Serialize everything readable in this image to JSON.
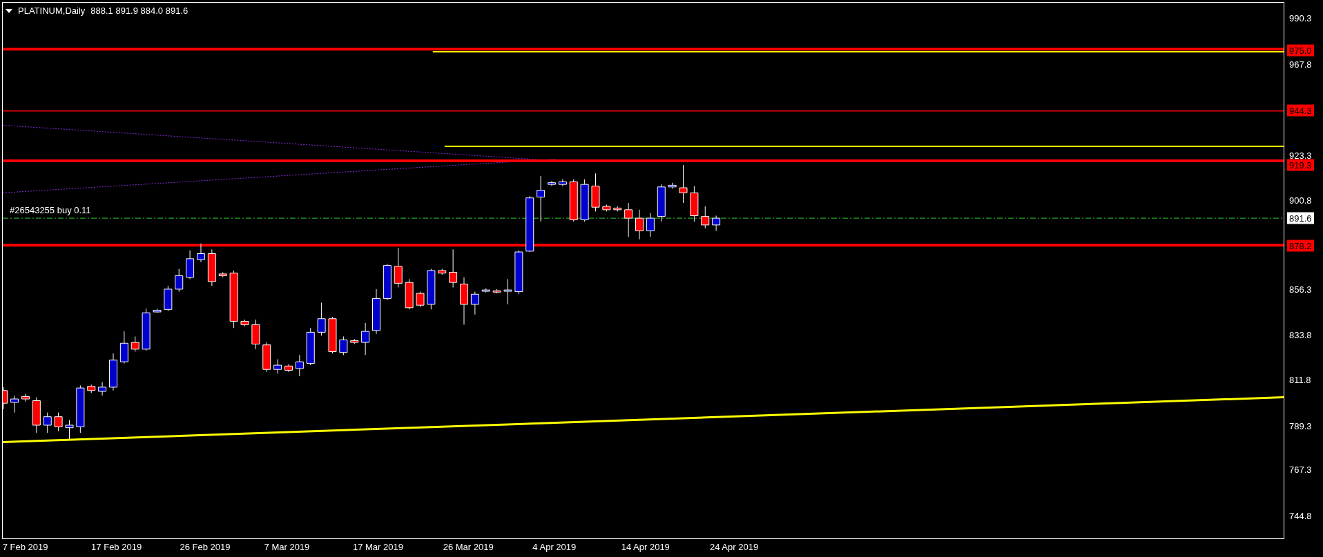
{
  "header": {
    "symbol": "PLATINUM,Daily",
    "ohlc": "888.1 891.9 884.0 891.6"
  },
  "order_label": "#26543255 buy 0.11",
  "price_axis": [
    "990.3",
    "967.8",
    "923.3",
    "900.8",
    "856.3",
    "833.8",
    "811.8",
    "789.3",
    "767.3",
    "744.8"
  ],
  "price_tags": [
    {
      "kind": "level",
      "text": "975.0"
    },
    {
      "kind": "level",
      "text": "944.3"
    },
    {
      "kind": "level",
      "text": "919.3"
    },
    {
      "kind": "current",
      "text": "891.6"
    },
    {
      "kind": "level",
      "text": "878.2"
    }
  ],
  "date_axis": [
    "7 Feb 2019",
    "17 Feb 2019",
    "26 Feb 2019",
    "7 Mar 2019",
    "17 Mar 2019",
    "26 Mar 2019",
    "4 Apr 2019",
    "14 Apr 2019",
    "24 Apr 2019"
  ]
}
